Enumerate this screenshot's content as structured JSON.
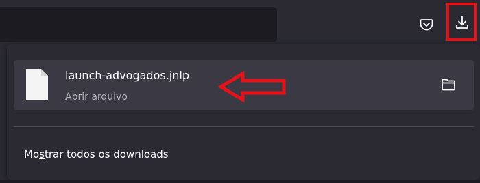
{
  "download": {
    "filename": "launch-advogados.jnlp",
    "status": "Abrir arquivo"
  },
  "footer": {
    "show_all_prefix": "Mo",
    "show_all_accesskey": "s",
    "show_all_suffix": "trar todos os downloads"
  },
  "icons": {
    "pocket": "pocket-icon",
    "download": "download-icon",
    "file": "file-icon",
    "folder": "folder-icon",
    "annotation_arrow": "arrow-left-icon"
  },
  "colors": {
    "annotation_red": "#e3131a",
    "panel_bg": "#2b2a33",
    "item_bg": "#3a3944",
    "text_primary": "#fbfbfe",
    "text_secondary": "#b0b0b8"
  }
}
